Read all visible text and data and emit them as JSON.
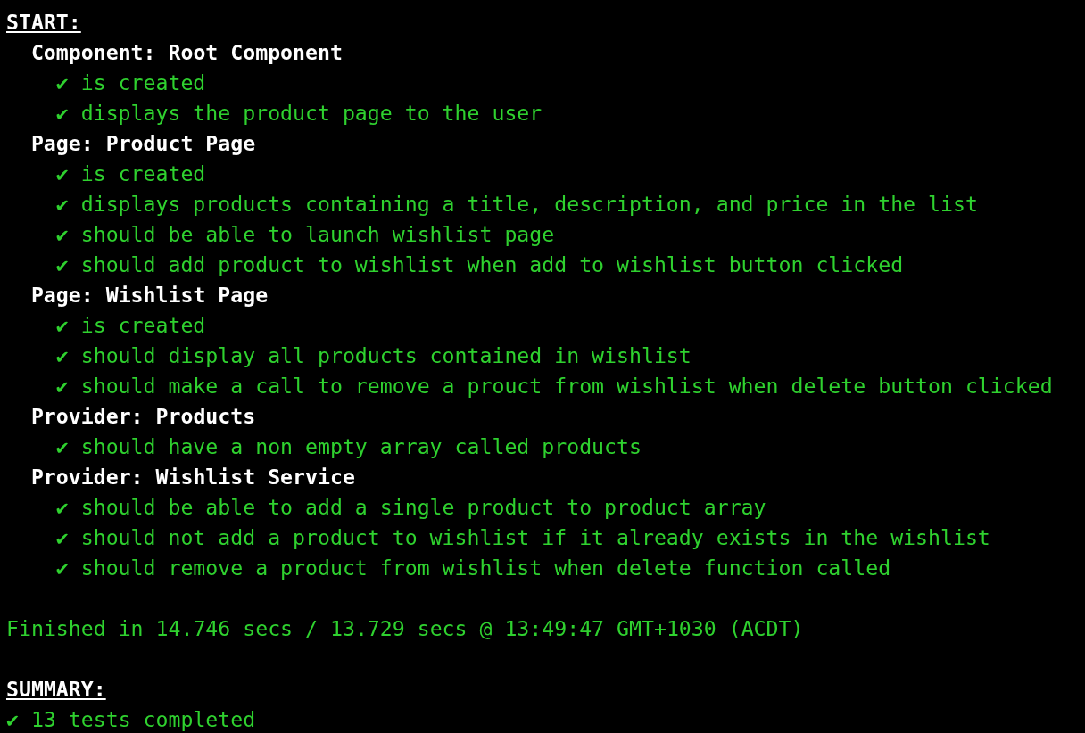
{
  "start_heading": "START:",
  "suites": [
    {
      "name": "Component: Root Component",
      "specs": [
        {
          "mark": "✔",
          "text": "is created"
        },
        {
          "mark": "✔",
          "text": "displays the product page to the user"
        }
      ]
    },
    {
      "name": "Page: Product Page",
      "specs": [
        {
          "mark": "✔",
          "text": "is created"
        },
        {
          "mark": "✔",
          "text": "displays products containing a title, description, and price in the list"
        },
        {
          "mark": "✔",
          "text": "should be able to launch wishlist page"
        },
        {
          "mark": "✔",
          "text": "should add product to wishlist when add to wishlist button clicked"
        }
      ]
    },
    {
      "name": "Page: Wishlist Page",
      "specs": [
        {
          "mark": "✔",
          "text": "is created"
        },
        {
          "mark": "✔",
          "text": "should display all products contained in wishlist"
        },
        {
          "mark": "✔",
          "text": "should make a call to remove a prouct from wishlist when delete button clicked"
        }
      ]
    },
    {
      "name": "Provider: Products",
      "specs": [
        {
          "mark": "✔",
          "text": "should have a non empty array called products"
        }
      ]
    },
    {
      "name": "Provider: Wishlist Service",
      "specs": [
        {
          "mark": "✔",
          "text": "should be able to add a single product to product array"
        },
        {
          "mark": "✔",
          "text": "should not add a product to wishlist if it already exists in the wishlist"
        },
        {
          "mark": "✔",
          "text": "should remove a product from wishlist when delete function called"
        }
      ]
    }
  ],
  "finished": "Finished in 14.746 secs / 13.729 secs @ 13:49:47 GMT+1030 (ACDT)",
  "summary_heading": "SUMMARY:",
  "summary": {
    "mark": "✔",
    "text": "13 tests completed"
  }
}
